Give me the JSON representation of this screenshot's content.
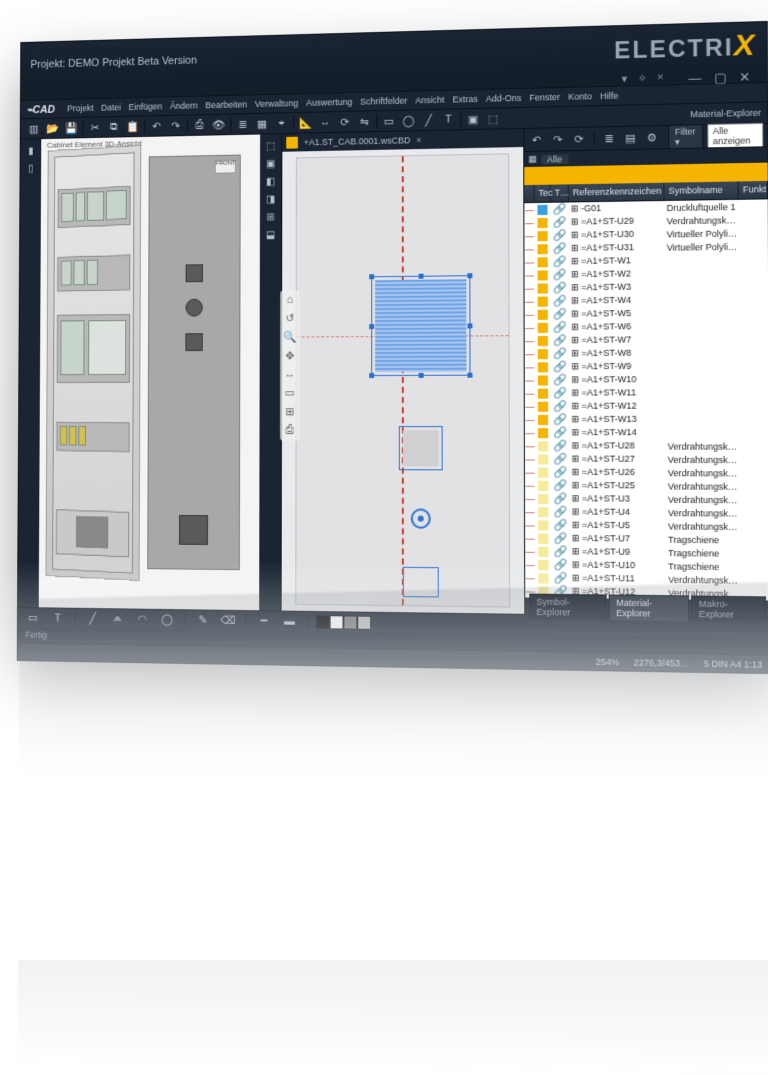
{
  "title": "Projekt: DEMO Projekt Beta Version",
  "logo": {
    "pre": "ELECTRI",
    "x": "X"
  },
  "menus": [
    "Projekt",
    "Datei",
    "Einfügen",
    "Ändern",
    "Bearbeiten",
    "Verwaltung",
    "Auswertung",
    "Schriftfelder",
    "Ansicht",
    "Extras",
    "Add-Ons",
    "Fenster",
    "Konto",
    "Hilfe"
  ],
  "leftHeader": "Cabinet Element 3D-Ansicht",
  "frontLabel": "FRONT",
  "centerTab": "+A1.ST_CAB.0001.wsCBD",
  "navIcons": [
    "⌂",
    "↺",
    "🔍",
    "✥",
    "↔",
    "▭",
    "⊞",
    "⎙"
  ],
  "explorer": {
    "panel": "Material-Explorer",
    "filterBtn": "Filter",
    "filterOpt": "Alle anzeigen",
    "bcAll": "Alle",
    "cols": [
      "",
      "Tec",
      "T…",
      "Referenzkennzeichen",
      "Symbolname",
      "Funkt"
    ],
    "rows": [
      {
        "sw": "#3aa0e0",
        "r": "-G01",
        "s": "Druckluftquelle 1"
      },
      {
        "sw": "#f5b400",
        "r": "=A1+ST-U29",
        "s": "Verdrahtungsk…"
      },
      {
        "sw": "#f5b400",
        "r": "=A1+ST-U30",
        "s": "Virtueller Polyli…"
      },
      {
        "sw": "#f5b400",
        "r": "=A1+ST-U31",
        "s": "Virtueller Polyli…"
      },
      {
        "sw": "#f5b400",
        "r": "=A1+ST-W1",
        "s": ""
      },
      {
        "sw": "#f5b400",
        "r": "=A1+ST-W2",
        "s": ""
      },
      {
        "sw": "#f5b400",
        "r": "=A1+ST-W3",
        "s": ""
      },
      {
        "sw": "#f5b400",
        "r": "=A1+ST-W4",
        "s": ""
      },
      {
        "sw": "#f5b400",
        "r": "=A1+ST-W5",
        "s": ""
      },
      {
        "sw": "#f5b400",
        "r": "=A1+ST-W6",
        "s": ""
      },
      {
        "sw": "#f5b400",
        "r": "=A1+ST-W7",
        "s": ""
      },
      {
        "sw": "#f5b400",
        "r": "=A1+ST-W8",
        "s": ""
      },
      {
        "sw": "#f5b400",
        "r": "=A1+ST-W9",
        "s": ""
      },
      {
        "sw": "#f5b400",
        "r": "=A1+ST-W10",
        "s": ""
      },
      {
        "sw": "#f5b400",
        "r": "=A1+ST-W11",
        "s": ""
      },
      {
        "sw": "#f5b400",
        "r": "=A1+ST-W12",
        "s": ""
      },
      {
        "sw": "#f5b400",
        "r": "=A1+ST-W13",
        "s": ""
      },
      {
        "sw": "#f5b400",
        "r": "=A1+ST-W14",
        "s": ""
      },
      {
        "sw": "#f5ec9a",
        "r": "=A1+ST-U28",
        "s": "Verdrahtungsk…"
      },
      {
        "sw": "#f5ec9a",
        "r": "=A1+ST-U27",
        "s": "Verdrahtungsk…"
      },
      {
        "sw": "#f5ec9a",
        "r": "=A1+ST-U26",
        "s": "Verdrahtungsk…"
      },
      {
        "sw": "#f5ec9a",
        "r": "=A1+ST-U25",
        "s": "Verdrahtungsk…"
      },
      {
        "sw": "#f5ec9a",
        "r": "=A1+ST-U3",
        "s": "Verdrahtungsk…"
      },
      {
        "sw": "#f5ec9a",
        "r": "=A1+ST-U4",
        "s": "Verdrahtungsk…"
      },
      {
        "sw": "#f5ec9a",
        "r": "=A1+ST-U5",
        "s": "Verdrahtungsk…"
      },
      {
        "sw": "#f5ec9a",
        "r": "=A1+ST-U7",
        "s": "Tragschiene"
      },
      {
        "sw": "#f5ec9a",
        "r": "=A1+ST-U9",
        "s": "Tragschiene"
      },
      {
        "sw": "#f5ec9a",
        "r": "=A1+ST-U10",
        "s": "Tragschiene"
      },
      {
        "sw": "#f5ec9a",
        "r": "=A1+ST-U11",
        "s": "Verdrahtungsk…"
      },
      {
        "sw": "#f5ec9a",
        "r": "=A1+ST-U12",
        "s": "Verdrahtungsk…"
      }
    ],
    "tabs": [
      "Symbol-Explorer",
      "Material-Explorer",
      "Makro-Explorer"
    ]
  },
  "status": {
    "zoom": "254%",
    "coords": "2276,3/453…",
    "page": "5  DIN A4  1:13",
    "ready": "Fertig"
  },
  "palette": [
    "#000000",
    "#ffffff",
    "#808080",
    "#c0c0c0"
  ]
}
